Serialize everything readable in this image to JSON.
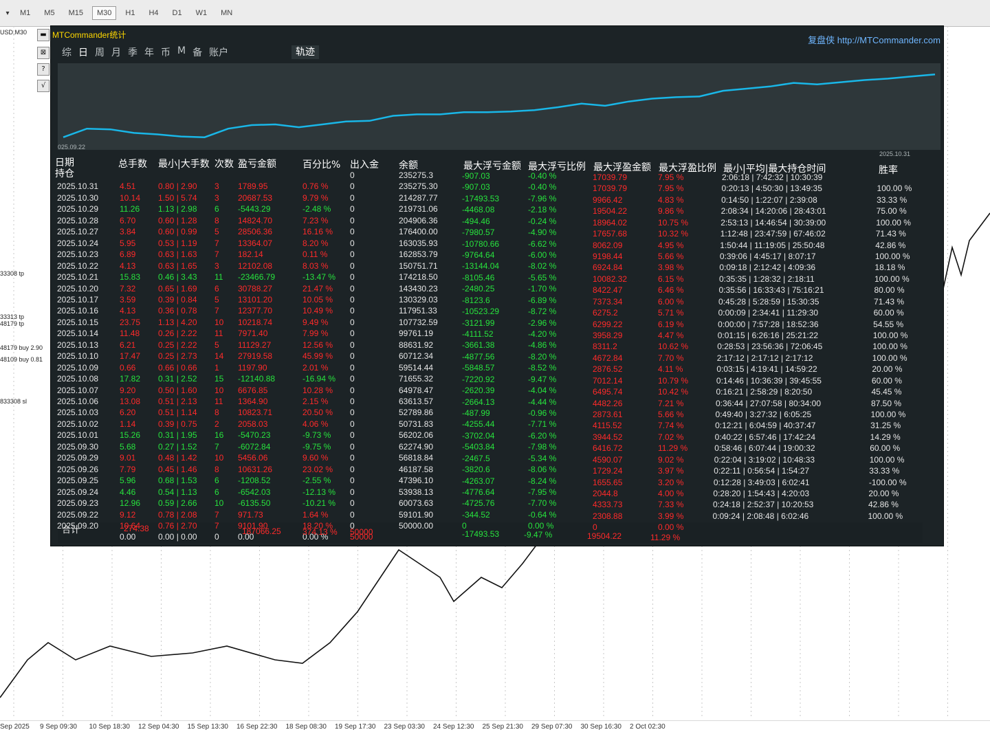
{
  "toolbar": {
    "timeframes": [
      "M1",
      "M5",
      "M15",
      "M30",
      "H1",
      "H4",
      "D1",
      "W1",
      "MN"
    ],
    "active": "M30"
  },
  "left_labels": {
    "symbol": "USD,M30",
    "tags": [
      "33308 tp",
      "33313 tp",
      "48179 tp",
      "48179 buy 2.90",
      "48109 buy 0.81",
      "833308 sl"
    ]
  },
  "panel": {
    "title": "MTCommander统计",
    "brand": "复盘侠 http://MTCommander.com",
    "tabs": [
      "综",
      "日",
      "周",
      "月",
      "季",
      "年",
      "币",
      "M",
      "备",
      "账户"
    ],
    "active_tab": "日",
    "track_tab": "轨迹",
    "date_start": "025.09.22",
    "date_end": "2025.10.31"
  },
  "table": {
    "headers": [
      "日期",
      "总手数",
      "最小|大手数",
      "次数",
      "盈亏金额",
      "百分比%",
      "出入金",
      "余额",
      "最大浮亏金额",
      "最大浮亏比例",
      "最大浮盈金额",
      "最大浮盈比例",
      "最小|平均|最大持仓时间",
      "胜率"
    ],
    "row_holding": "持仓",
    "rows": [
      {
        "date": "",
        "lots": "",
        "minmax": "",
        "count": "",
        "pnl": "",
        "pct": "",
        "io": "0",
        "bal": "235275.3",
        "mfl": "-907.03",
        "mflp": "-0.40 %",
        "mfp": "17039.79",
        "mfpp": "7.95 %",
        "time": "2:06:18 | 7:42:32 | 10:30:39",
        "win": ""
      },
      {
        "date": "2025.10.31",
        "lots": "4.51",
        "minmax": "0.80 | 2.90",
        "count": "3",
        "pnl": "1789.95",
        "pct": "0.76 %",
        "io": "0",
        "bal": "235275.30",
        "mfl": "-907.03",
        "mflp": "-0.40 %",
        "mfp": "17039.79",
        "mfpp": "7.95 %",
        "time": "0:20:13 | 4:50:30 | 13:49:35",
        "win": "100.00 %"
      },
      {
        "date": "2025.10.30",
        "lots": "10.14",
        "minmax": "1.50 | 5.74",
        "count": "3",
        "pnl": "20687.53",
        "pct": "9.79 %",
        "io": "0",
        "bal": "214287.77",
        "mfl": "-17493.53",
        "mflp": "-7.96 %",
        "mfp": "9966.42",
        "mfpp": "4.83 %",
        "time": "0:14:50 | 1:22:07 | 2:39:08",
        "win": "33.33 %"
      },
      {
        "date": "2025.10.29",
        "lots": "11.26",
        "minmax": "1.13 | 2.98",
        "count": "6",
        "pnl": "-5443.29",
        "pct": "-2.48 %",
        "io": "0",
        "bal": "219731.06",
        "mfl": "-4468.08",
        "mflp": "-2.18 %",
        "mfp": "19504.22",
        "mfpp": "9.86 %",
        "time": "2:08:34 | 14:20:06 | 28:43:01",
        "win": "75.00 %"
      },
      {
        "date": "2025.10.28",
        "lots": "6.70",
        "minmax": "0.60 | 1.28",
        "count": "8",
        "pnl": "14824.70",
        "pct": "7.23 %",
        "io": "0",
        "bal": "204906.36",
        "mfl": "-494.46",
        "mflp": "-0.24 %",
        "mfp": "18964.02",
        "mfpp": "10.75 %",
        "time": "2:53:13 | 14:46:54 | 30:39:00",
        "win": "100.00 %"
      },
      {
        "date": "2025.10.27",
        "lots": "3.84",
        "minmax": "0.60 | 0.99",
        "count": "5",
        "pnl": "28506.36",
        "pct": "16.16 %",
        "io": "0",
        "bal": "176400.00",
        "mfl": "-7980.57",
        "mflp": "-4.90 %",
        "mfp": "17657.68",
        "mfpp": "10.32 %",
        "time": "1:12:48 | 23:47:59 | 67:46:02",
        "win": "71.43 %"
      },
      {
        "date": "2025.10.24",
        "lots": "5.95",
        "minmax": "0.53 | 1.19",
        "count": "7",
        "pnl": "13364.07",
        "pct": "8.20 %",
        "io": "0",
        "bal": "163035.93",
        "mfl": "-10780.66",
        "mflp": "-6.62 %",
        "mfp": "8062.09",
        "mfpp": "4.95 %",
        "time": "1:50:44 | 11:19:05 | 25:50:48",
        "win": "42.86 %"
      },
      {
        "date": "2025.10.23",
        "lots": "6.89",
        "minmax": "0.63 | 1.63",
        "count": "7",
        "pnl": "182.14",
        "pct": "0.11 %",
        "io": "0",
        "bal": "162853.79",
        "mfl": "-9764.64",
        "mflp": "-6.00 %",
        "mfp": "9198.44",
        "mfpp": "5.66 %",
        "time": "0:39:06 | 4:45:17 | 8:07:17",
        "win": "100.00 %"
      },
      {
        "date": "2025.10.22",
        "lots": "4.13",
        "minmax": "0.63 | 1.65",
        "count": "3",
        "pnl": "12102.08",
        "pct": "8.03 %",
        "io": "0",
        "bal": "150751.71",
        "mfl": "-13144.04",
        "mflp": "-8.02 %",
        "mfp": "6924.84",
        "mfpp": "3.98 %",
        "time": "0:09:18 | 2:12:42 | 4:09:36",
        "win": "18.18 %"
      },
      {
        "date": "2025.10.21",
        "lots": "15.83",
        "minmax": "0.46 | 3.43",
        "count": "11",
        "pnl": "-23466.79",
        "pct": "-13.47 %",
        "io": "0",
        "bal": "174218.50",
        "mfl": "-8105.46",
        "mflp": "-5.65 %",
        "mfp": "10082.32",
        "mfpp": "6.15 %",
        "time": "0:35:35 | 1:28:32 | 2:18:11",
        "win": "100.00 %"
      },
      {
        "date": "2025.10.20",
        "lots": "7.32",
        "minmax": "0.65 | 1.69",
        "count": "6",
        "pnl": "30788.27",
        "pct": "21.47 %",
        "io": "0",
        "bal": "143430.23",
        "mfl": "-2480.25",
        "mflp": "-1.70 %",
        "mfp": "8422.47",
        "mfpp": "6.46 %",
        "time": "0:35:56 | 16:33:43 | 75:16:21",
        "win": "80.00 %"
      },
      {
        "date": "2025.10.17",
        "lots": "3.59",
        "minmax": "0.39 | 0.84",
        "count": "5",
        "pnl": "13101.20",
        "pct": "10.05 %",
        "io": "0",
        "bal": "130329.03",
        "mfl": "-8123.6",
        "mflp": "-6.89 %",
        "mfp": "7373.34",
        "mfpp": "6.00 %",
        "time": "0:45:28 | 5:28:59 | 15:30:35",
        "win": "71.43 %"
      },
      {
        "date": "2025.10.16",
        "lots": "4.13",
        "minmax": "0.36 | 0.78",
        "count": "7",
        "pnl": "12377.70",
        "pct": "10.49 %",
        "io": "0",
        "bal": "117951.33",
        "mfl": "-10523.29",
        "mflp": "-8.72 %",
        "mfp": "6275.2",
        "mfpp": "5.71 %",
        "time": "0:00:09 | 2:34:41 | 11:29:30",
        "win": "60.00 %"
      },
      {
        "date": "2025.10.15",
        "lots": "23.75",
        "minmax": "1.13 | 4.20",
        "count": "10",
        "pnl": "10218.74",
        "pct": "9.49 %",
        "io": "0",
        "bal": "107732.59",
        "mfl": "-3121.99",
        "mflp": "-2.96 %",
        "mfp": "6299.22",
        "mfpp": "6.19 %",
        "time": "0:00:00 | 7:57:28 | 18:52:36",
        "win": "54.55 %"
      },
      {
        "date": "2025.10.14",
        "lots": "11.48",
        "minmax": "0.26 | 2.22",
        "count": "11",
        "pnl": "7971.40",
        "pct": "7.99 %",
        "io": "0",
        "bal": "99761.19",
        "mfl": "-4111.52",
        "mflp": "-4.20 %",
        "mfp": "3958.29",
        "mfpp": "4.47 %",
        "time": "0:01:15 | 6:26:16 | 25:21:22",
        "win": "100.00 %"
      },
      {
        "date": "2025.10.13",
        "lots": "6.21",
        "minmax": "0.25 | 2.22",
        "count": "5",
        "pnl": "11129.27",
        "pct": "12.56 %",
        "io": "0",
        "bal": "88631.92",
        "mfl": "-3661.38",
        "mflp": "-4.86 %",
        "mfp": "8311.2",
        "mfpp": "10.62 %",
        "time": "0:28:53 | 23:56:36 | 72:06:45",
        "win": "100.00 %"
      },
      {
        "date": "2025.10.10",
        "lots": "17.47",
        "minmax": "0.25 | 2.73",
        "count": "14",
        "pnl": "27919.58",
        "pct": "45.99 %",
        "io": "0",
        "bal": "60712.34",
        "mfl": "-4877.56",
        "mflp": "-8.20 %",
        "mfp": "4672.84",
        "mfpp": "7.70 %",
        "time": "2:17:12 | 2:17:12 | 2:17:12",
        "win": "100.00 %"
      },
      {
        "date": "2025.10.09",
        "lots": "0.66",
        "minmax": "0.66 | 0.66",
        "count": "1",
        "pnl": "1197.90",
        "pct": "2.01 %",
        "io": "0",
        "bal": "59514.44",
        "mfl": "-5848.57",
        "mflp": "-8.52 %",
        "mfp": "2876.52",
        "mfpp": "4.11 %",
        "time": "0:03:15 | 4:19:41 | 14:59:22",
        "win": "20.00 %"
      },
      {
        "date": "2025.10.08",
        "lots": "17.82",
        "minmax": "0.31 | 2.52",
        "count": "15",
        "pnl": "-12140.88",
        "pct": "-16.94 %",
        "io": "0",
        "bal": "71655.32",
        "mfl": "-7220.92",
        "mflp": "-9.47 %",
        "mfp": "7012.14",
        "mfpp": "10.79 %",
        "time": "0:14:46 | 10:36:39 | 39:45:55",
        "win": "60.00 %"
      },
      {
        "date": "2025.10.07",
        "lots": "9.20",
        "minmax": "0.50 | 1.60",
        "count": "10",
        "pnl": "6676.85",
        "pct": "10.28 %",
        "io": "0",
        "bal": "64978.47",
        "mfl": "-2620.39",
        "mflp": "-4.04 %",
        "mfp": "6495.74",
        "mfpp": "10.42 %",
        "time": "0:16:21 | 2:58:29 | 8:20:50",
        "win": "45.45 %"
      },
      {
        "date": "2025.10.06",
        "lots": "13.08",
        "minmax": "0.51 | 2.13",
        "count": "11",
        "pnl": "1364.90",
        "pct": "2.15 %",
        "io": "0",
        "bal": "63613.57",
        "mfl": "-2664.13",
        "mflp": "-4.44 %",
        "mfp": "4482.26",
        "mfpp": "7.21 %",
        "time": "0:36:44 | 27:07:58 | 80:34:00",
        "win": "87.50 %"
      },
      {
        "date": "2025.10.03",
        "lots": "6.20",
        "minmax": "0.51 | 1.14",
        "count": "8",
        "pnl": "10823.71",
        "pct": "20.50 %",
        "io": "0",
        "bal": "52789.86",
        "mfl": "-487.99",
        "mflp": "-0.96 %",
        "mfp": "2873.61",
        "mfpp": "5.66 %",
        "time": "0:49:40 | 3:27:32 | 6:05:25",
        "win": "100.00 %"
      },
      {
        "date": "2025.10.02",
        "lots": "1.14",
        "minmax": "0.39 | 0.75",
        "count": "2",
        "pnl": "2058.03",
        "pct": "4.06 %",
        "io": "0",
        "bal": "50731.83",
        "mfl": "-4255.44",
        "mflp": "-7.71 %",
        "mfp": "4115.52",
        "mfpp": "7.74 %",
        "time": "0:12:21 | 6:04:59 | 40:37:47",
        "win": "31.25 %"
      },
      {
        "date": "2025.10.01",
        "lots": "15.26",
        "minmax": "0.31 | 1.95",
        "count": "16",
        "pnl": "-5470.23",
        "pct": "-9.73 %",
        "io": "0",
        "bal": "56202.06",
        "mfl": "-3702.04",
        "mflp": "-6.20 %",
        "mfp": "3944.52",
        "mfpp": "7.02 %",
        "time": "0:40:22 | 6:57:46 | 17:42:24",
        "win": "14.29 %"
      },
      {
        "date": "2025.09.30",
        "lots": "5.68",
        "minmax": "0.27 | 1.52",
        "count": "7",
        "pnl": "-6072.84",
        "pct": "-9.75 %",
        "io": "0",
        "bal": "62274.90",
        "mfl": "-5403.84",
        "mflp": "-7.98 %",
        "mfp": "6416.72",
        "mfpp": "11.29 %",
        "time": "0:58:46 | 6:07:44 | 19:00:32",
        "win": "60.00 %"
      },
      {
        "date": "2025.09.29",
        "lots": "9.01",
        "minmax": "0.48 | 1.42",
        "count": "10",
        "pnl": "5456.06",
        "pct": "9.60 %",
        "io": "0",
        "bal": "56818.84",
        "mfl": "-2467.5",
        "mflp": "-5.34 %",
        "mfp": "4590.07",
        "mfpp": "9.02 %",
        "time": "0:22:04 | 3:19:02 | 10:48:33",
        "win": "100.00 %"
      },
      {
        "date": "2025.09.26",
        "lots": "7.79",
        "minmax": "0.45 | 1.46",
        "count": "8",
        "pnl": "10631.26",
        "pct": "23.02 %",
        "io": "0",
        "bal": "46187.58",
        "mfl": "-3820.6",
        "mflp": "-8.06 %",
        "mfp": "1729.24",
        "mfpp": "3.97 %",
        "time": "0:22:11 | 0:56:54 | 1:54:27",
        "win": "33.33 %"
      },
      {
        "date": "2025.09.25",
        "lots": "5.96",
        "minmax": "0.68 | 1.53",
        "count": "6",
        "pnl": "-1208.52",
        "pct": "-2.55 %",
        "io": "0",
        "bal": "47396.10",
        "mfl": "-4263.07",
        "mflp": "-8.24 %",
        "mfp": "1655.65",
        "mfpp": "3.20 %",
        "time": "0:12:28 | 3:49:03 | 6:02:41",
        "win": "-100.00 %"
      },
      {
        "date": "2025.09.24",
        "lots": "4.46",
        "minmax": "0.54 | 1.13",
        "count": "6",
        "pnl": "-6542.03",
        "pct": "-12.13 %",
        "io": "0",
        "bal": "53938.13",
        "mfl": "-4776.64",
        "mflp": "-7.95 %",
        "mfp": "2044.8",
        "mfpp": "4.00 %",
        "time": "0:28:20 | 1:54:43 | 4:20:03",
        "win": "20.00 %"
      },
      {
        "date": "2025.09.23",
        "lots": "12.96",
        "minmax": "0.59 | 2.66",
        "count": "10",
        "pnl": "-6135.50",
        "pct": "-10.21 %",
        "io": "0",
        "bal": "60073.63",
        "mfl": "-4725.76",
        "mflp": "-7.70 %",
        "mfp": "4333.73",
        "mfpp": "7.33 %",
        "time": "0:24:18 | 2:52:37 | 10:20:53",
        "win": "42.86 %"
      },
      {
        "date": "2025.09.22",
        "lots": "9.12",
        "minmax": "0.78 | 2.08",
        "count": "7",
        "pnl": "971.73",
        "pct": "1.64 %",
        "io": "0",
        "bal": "59101.90",
        "mfl": "-344.52",
        "mflp": "-0.64 %",
        "mfp": "2308.88",
        "mfpp": "3.99 %",
        "time": "0:09:24 | 2:08:48 | 6:02:46",
        "win": "100.00 %"
      },
      {
        "date": "2025.09.20",
        "lots": "10.64",
        "minmax": "0.76 | 2.70",
        "count": "7",
        "pnl": "9101.90",
        "pct": "18.20 %",
        "io": "0",
        "bal": "50000.00",
        "mfl": "0",
        "mflp": "0.00 %",
        "mfp": "0",
        "mfpp": "0.00 %",
        "time": "",
        "win": ""
      },
      {
        "date": "",
        "lots": "0.00",
        "minmax": "0.00 | 0.00",
        "count": "0",
        "pnl": "0.00",
        "pct": "0.00 %",
        "io": "50000",
        "bal": "",
        "mfl": "",
        "mflp": "",
        "mfp": "",
        "mfpp": "",
        "time": "",
        "win": ""
      }
    ],
    "total": {
      "label": "合计",
      "lots": "274.38",
      "pnl": "187066.25",
      "pct": "374.13 %",
      "io": "50000",
      "mfl": "-17493.53",
      "mflp": "-9.47 %",
      "mfp": "19504.22",
      "mfpp": "11.29 %"
    }
  },
  "equity_curve": [
    0.08,
    0.2,
    0.19,
    0.14,
    0.12,
    0.09,
    0.08,
    0.2,
    0.25,
    0.26,
    0.22,
    0.26,
    0.3,
    0.31,
    0.38,
    0.4,
    0.4,
    0.43,
    0.43,
    0.44,
    0.46,
    0.5,
    0.55,
    0.52,
    0.58,
    0.62,
    0.64,
    0.65,
    0.73,
    0.76,
    0.79,
    0.84,
    0.82,
    0.85,
    0.88,
    0.9,
    0.93,
    0.96
  ],
  "time_axis": [
    "Sep 2025",
    "9 Sep 09:30",
    "10 Sep 18:30",
    "12 Sep 04:30",
    "15 Sep 13:30",
    "16 Sep 22:30",
    "18 Sep 08:30",
    "19 Sep 17:30",
    "23 Sep 03:30",
    "24 Sep 12:30",
    "25 Sep 21:30",
    "29 Sep 07:30",
    "30 Sep 16:30",
    "2 Oct 02:30"
  ],
  "colors": {
    "panel_bg": "#1c2326",
    "chart_bg": "#2e373a",
    "curve": "#19b7e8",
    "profit": "#ff2a2a",
    "loss": "#27e33d",
    "title": "#ffd800",
    "url": "#6fb6ff"
  }
}
